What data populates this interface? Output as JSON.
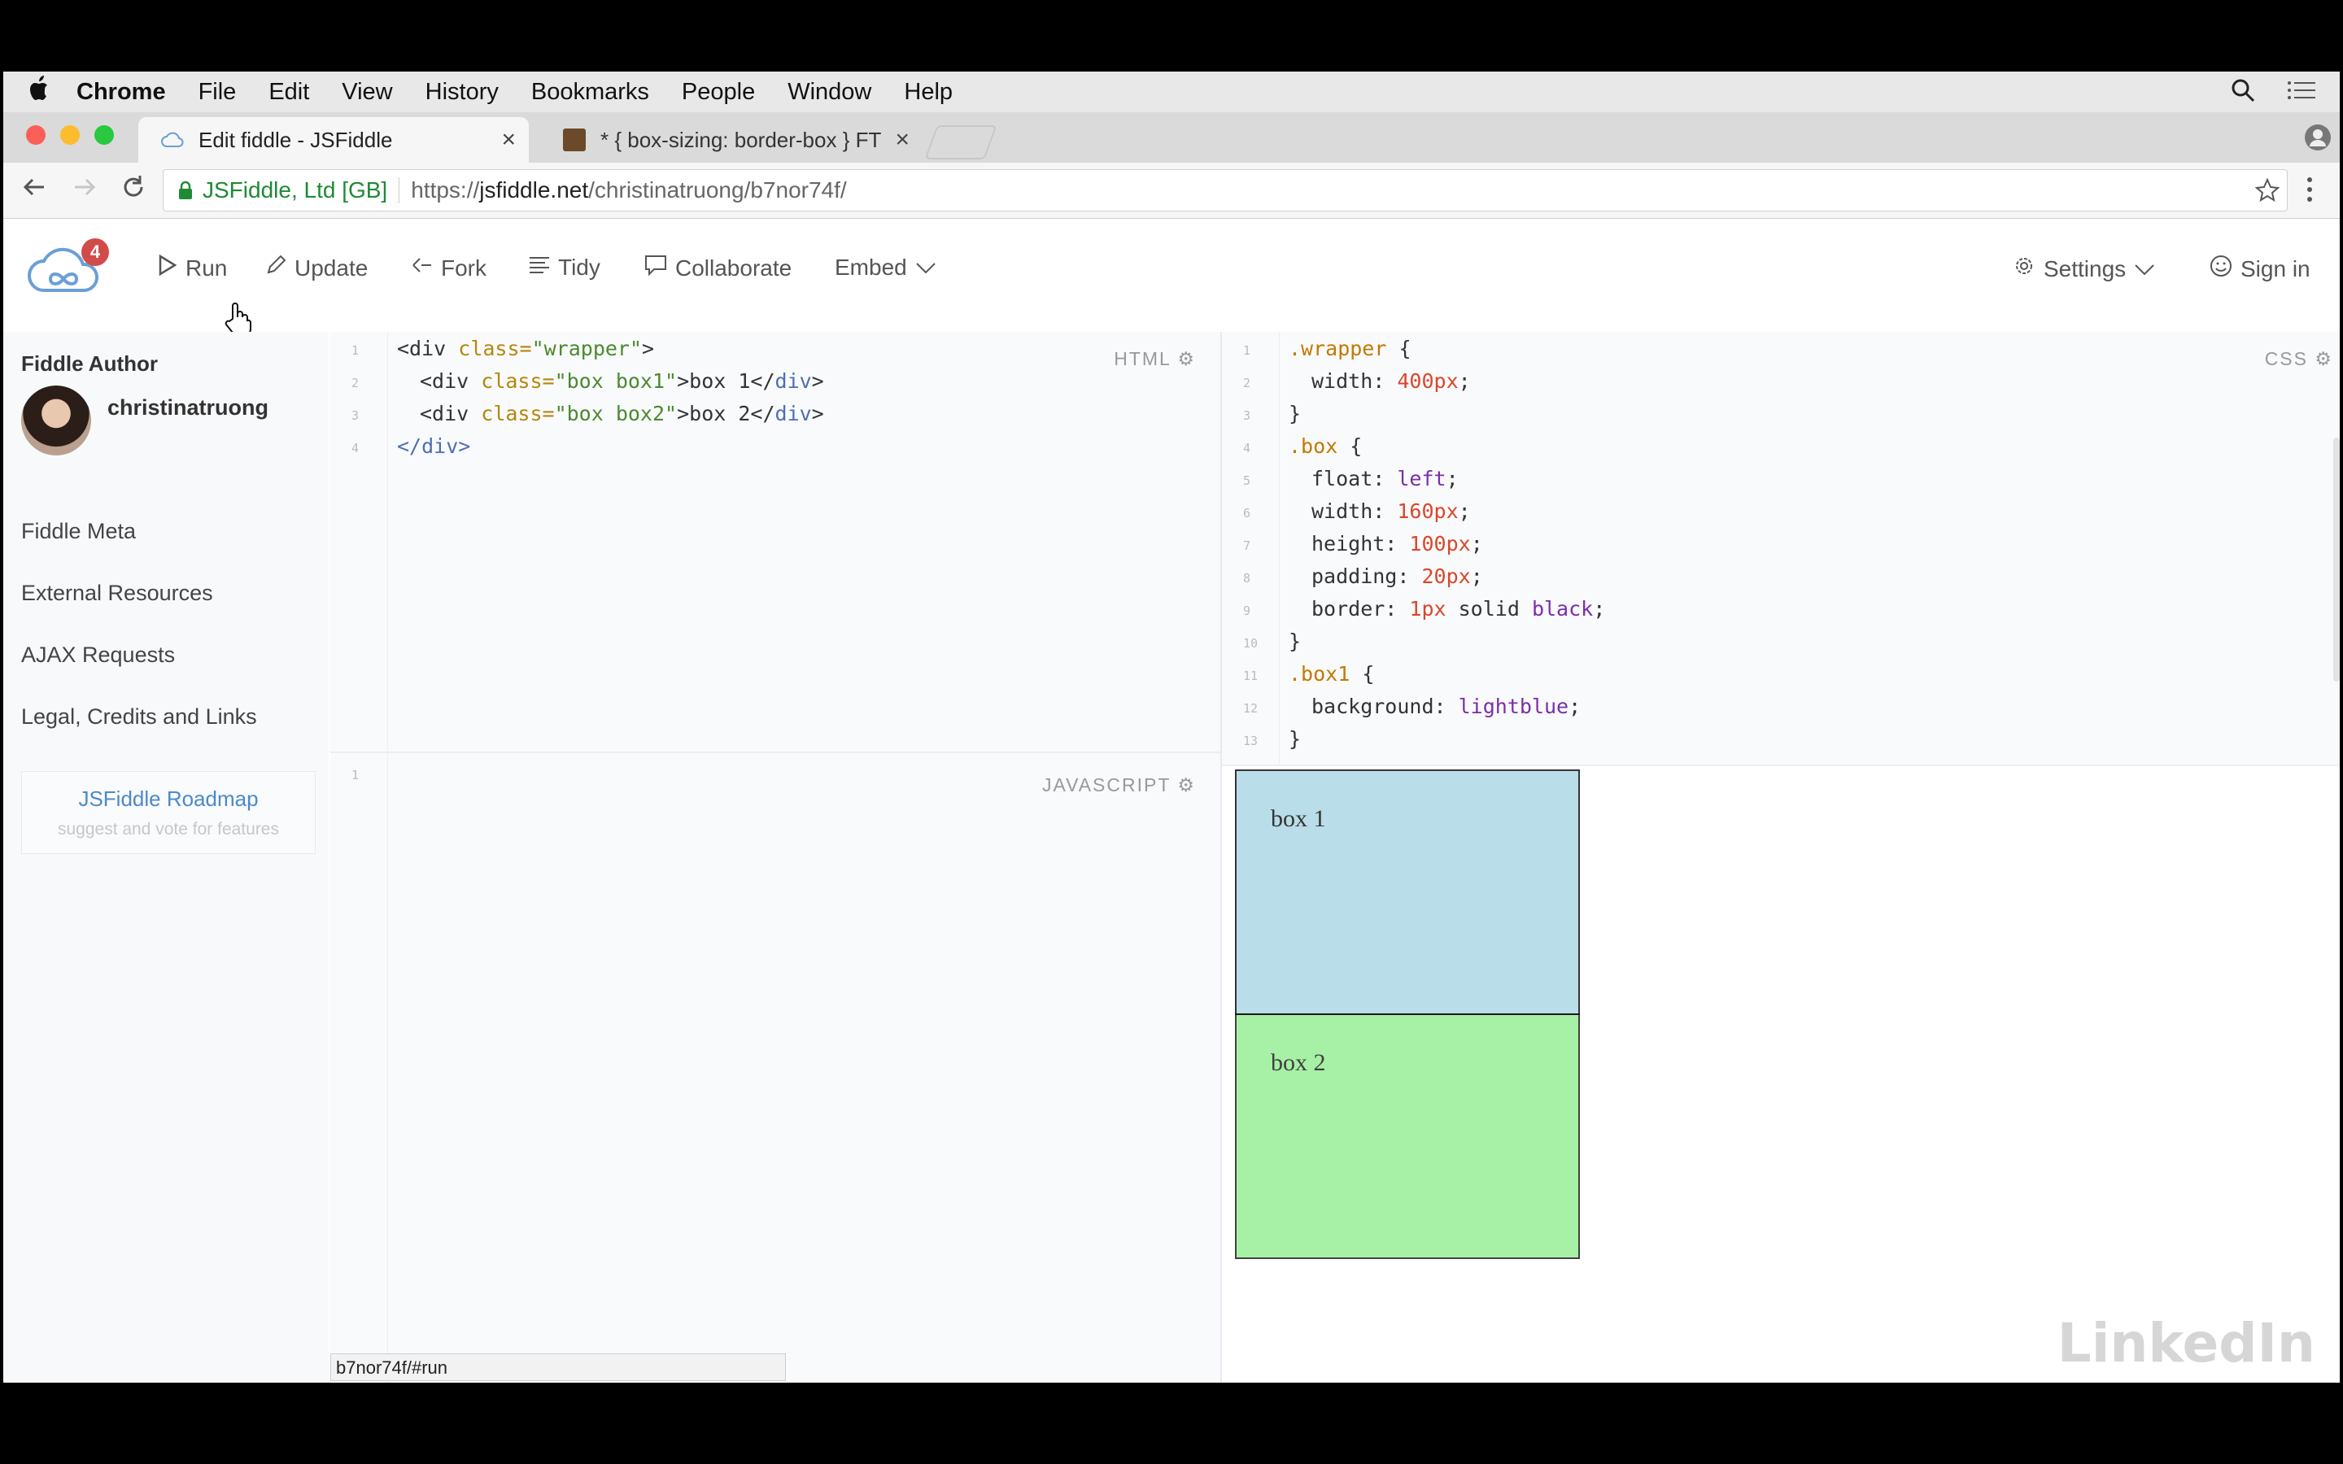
{
  "menubar": {
    "items": [
      "Chrome",
      "File",
      "Edit",
      "View",
      "History",
      "Bookmarks",
      "People",
      "Window",
      "Help"
    ]
  },
  "tabs": [
    {
      "title": "Edit fiddle - JSFiddle",
      "close": "×"
    },
    {
      "title": "* { box-sizing: border-box } FT",
      "close": "×"
    }
  ],
  "addressbar": {
    "secure_label": "JSFiddle, Ltd [GB]",
    "url_proto": "https://",
    "url_host": "jsfiddle.net",
    "url_path": "/christinatruong/b7nor74f/"
  },
  "jsfiddle": {
    "badge_count": "4",
    "actions": {
      "run": "Run",
      "update": "Update",
      "fork": "Fork",
      "tidy": "Tidy",
      "collaborate": "Collaborate",
      "embed": "Embed"
    },
    "settings": "Settings",
    "sign_in": "Sign in"
  },
  "sidebar": {
    "title": "Fiddle Author",
    "author": "christinatruong",
    "links": [
      "Fiddle Meta",
      "External Resources",
      "AJAX Requests",
      "Legal, Credits and Links"
    ],
    "roadmap_title": "JSFiddle Roadmap",
    "roadmap_sub": "suggest and vote for features"
  },
  "editors": {
    "html_label": "HTML",
    "css_label": "CSS",
    "js_label": "JAVASCRIPT",
    "html_line_numbers": [
      "1",
      "2",
      "3",
      "4"
    ],
    "css_line_numbers": [
      "1",
      "2",
      "3",
      "4",
      "5",
      "6",
      "7",
      "8",
      "9",
      "10",
      "11",
      "12",
      "13"
    ],
    "js_line_numbers": [
      "1"
    ],
    "html": {
      "l1_open": "<div ",
      "l1_attr": "class=",
      "l1_str": "\"wrapper\"",
      "l1_end": ">",
      "l2_open": "<div ",
      "l2_attr": "class=",
      "l2_str": "\"box box1\"",
      "l2_text": ">box 1</",
      "l2_tag": "div",
      "l2_end": ">",
      "l3_open": "<div ",
      "l3_attr": "class=",
      "l3_str": "\"box box2\"",
      "l3_text": ">box 2</",
      "l3_tag": "div",
      "l3_end": ">",
      "l4_close": "</div>"
    },
    "css": {
      "l1_sel": ".wrapper",
      "l1_brace": " {",
      "l2_prop": "width: ",
      "l2_val": "400px",
      "l2_end": ";",
      "l3": "}",
      "l4_sel": ".box",
      "l4_brace": " {",
      "l5_prop": "float: ",
      "l5_val": "left",
      "l5_end": ";",
      "l6_prop": "width: ",
      "l6_val": "160px",
      "l6_end": ";",
      "l7_prop": "height: ",
      "l7_val": "100px",
      "l7_end": ";",
      "l8_prop": "padding: ",
      "l8_val": "20px",
      "l8_end": ";",
      "l9_prop": "border: ",
      "l9_val1": "1px",
      "l9_val2": " solid ",
      "l9_val3": "black",
      "l9_end": ";",
      "l10": "}",
      "l11_sel": ".box1",
      "l11_brace": " {",
      "l12_prop": "background: ",
      "l12_val": "lightblue",
      "l12_end": ";",
      "l13": "}"
    }
  },
  "result": {
    "box1": "box 1",
    "box2": "box 2"
  },
  "statusbar": "b7nor74f/#run",
  "watermark": "LinkedIn",
  "colors": {
    "box1": "#add8e6",
    "box2": "#90ee90",
    "accent": "#4b8ac9"
  }
}
